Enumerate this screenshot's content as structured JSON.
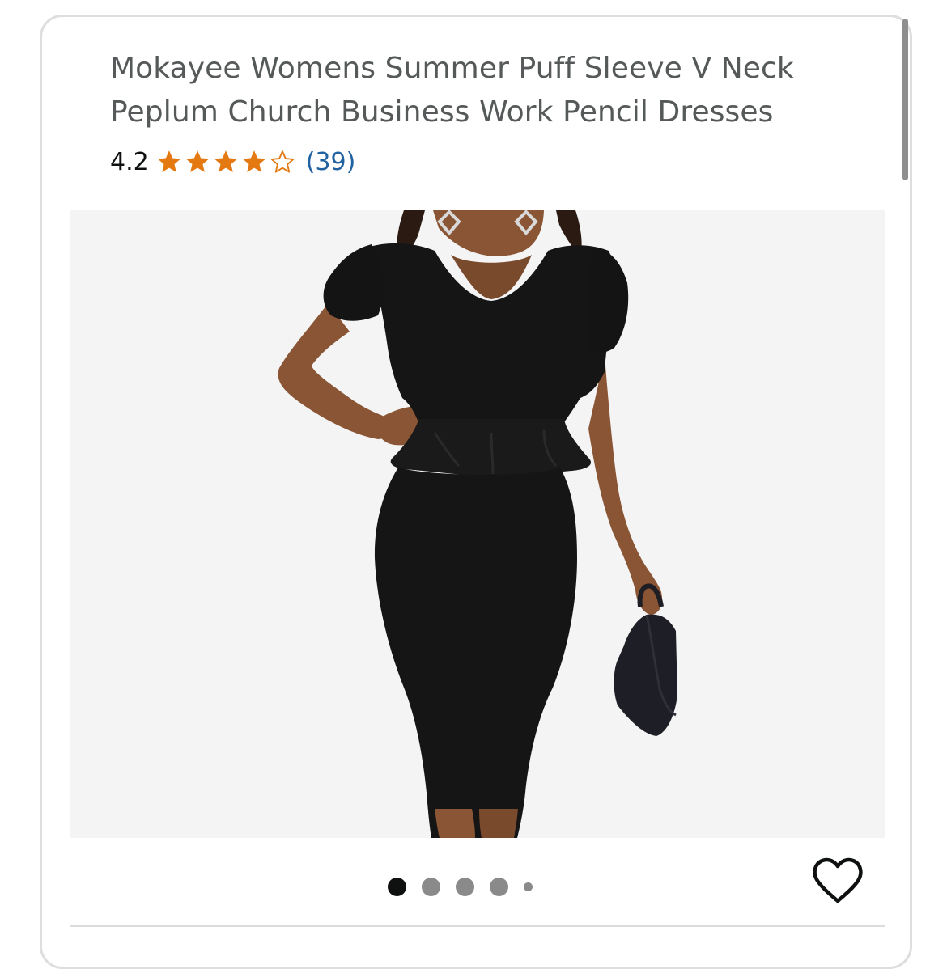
{
  "product": {
    "title": "Mokayee Womens Summer Puff Sleeve V Neck Peplum Church Business Work Pencil Dresses",
    "rating": "4.2",
    "rating_stars": 4.2,
    "rating_max": 5,
    "review_count": "(39)"
  },
  "image": {
    "alt": "Black peplum pencil dress with puff sleeves and V neck",
    "carousel_pages": 5,
    "active_index": 0
  },
  "icons": {
    "star_full": "star-icon",
    "star_empty": "star-outline-icon",
    "favorite": "heart-icon"
  },
  "colors": {
    "star": "#f3a847",
    "link": "#2162a1",
    "title": "#565959"
  }
}
